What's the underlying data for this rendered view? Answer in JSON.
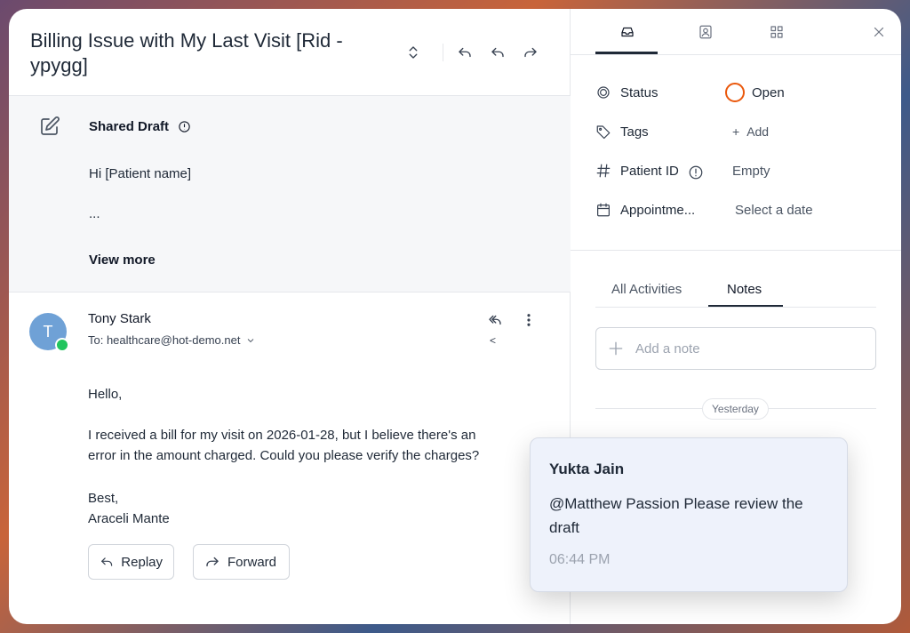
{
  "conversation": {
    "title": "Billing Issue with My Last Visit [Rid - ypygg]"
  },
  "draft": {
    "heading": "Shared Draft",
    "line1": "Hi [Patient name]",
    "line2": "...",
    "view_more": "View more"
  },
  "message": {
    "avatar_initial": "T",
    "sender": "Tony Stark",
    "to": "To: healthcare@hot-demo.net",
    "collapse_glyph": "<",
    "greeting": "Hello,",
    "body_line1": "I received a bill for my visit on 2026-01-28, but I believe there's an",
    "body_line2": "error in the amount charged. Could you please verify the charges?",
    "signoff": "Best,",
    "signature": "Araceli Mante",
    "reply_label": "Replay",
    "forward_label": "Forward"
  },
  "properties": {
    "status_label": "Status",
    "status_value": "Open",
    "tags_label": "Tags",
    "tags_action": "Add",
    "patient_id_label": "Patient ID",
    "patient_id_value": "Empty",
    "appointment_label": "Appointme...",
    "appointment_value": "Select a date"
  },
  "activity": {
    "tab_all": "All Activities",
    "tab_notes": "Notes",
    "add_note_placeholder": "Add a note",
    "day_divider": "Yesterday"
  },
  "note": {
    "author": "Yukta Jain",
    "text": "@Matthew Passion Please review the draft",
    "time": "06:44 PM"
  },
  "colors": {
    "status_open": "#ea580c",
    "avatar": "#6fa1d6",
    "online": "#22c55e"
  }
}
